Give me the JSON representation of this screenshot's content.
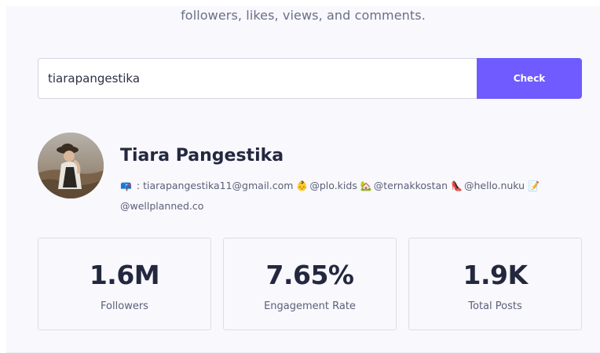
{
  "header": {
    "subtitle": "followers, likes, views, and comments."
  },
  "search": {
    "value": "tiarapangestika",
    "button_label": "Check"
  },
  "profile": {
    "name": "Tiara Pangestika",
    "bio_parts": [
      {
        "icon": "mailbox-icon",
        "glyph": "📪",
        "text": " : tiarapangestika11@gmail.com "
      },
      {
        "icon": "baby-icon",
        "glyph": "👶",
        "text": "@plo.kids "
      },
      {
        "icon": "house-icon",
        "glyph": "🏡",
        "text": "@ternakkostan "
      },
      {
        "icon": "high-heel-icon",
        "glyph": "👠",
        "text": "@hello.nuku "
      },
      {
        "icon": "memo-icon",
        "glyph": "📝",
        "text": ""
      }
    ],
    "bio_line2": "@wellplanned.co"
  },
  "stats": [
    {
      "value": "1.6M",
      "label": "Followers"
    },
    {
      "value": "7.65%",
      "label": "Engagement Rate"
    },
    {
      "value": "1.9K",
      "label": "Total Posts"
    }
  ],
  "colors": {
    "accent": "#6f5bff",
    "background": "#f8f8fd",
    "text_dark": "#23283f",
    "text_muted": "#5b6077"
  }
}
